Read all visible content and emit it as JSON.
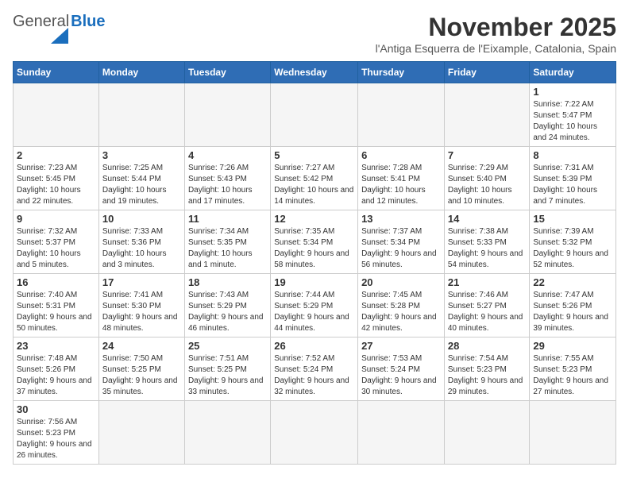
{
  "header": {
    "logo_general": "General",
    "logo_blue": "Blue",
    "month_title": "November 2025",
    "subtitle": "l'Antiga Esquerra de l'Eixample, Catalonia, Spain"
  },
  "days_of_week": [
    "Sunday",
    "Monday",
    "Tuesday",
    "Wednesday",
    "Thursday",
    "Friday",
    "Saturday"
  ],
  "weeks": [
    [
      {
        "day": "",
        "info": ""
      },
      {
        "day": "",
        "info": ""
      },
      {
        "day": "",
        "info": ""
      },
      {
        "day": "",
        "info": ""
      },
      {
        "day": "",
        "info": ""
      },
      {
        "day": "",
        "info": ""
      },
      {
        "day": "1",
        "info": "Sunrise: 7:22 AM\nSunset: 5:47 PM\nDaylight: 10 hours and 24 minutes."
      }
    ],
    [
      {
        "day": "2",
        "info": "Sunrise: 7:23 AM\nSunset: 5:45 PM\nDaylight: 10 hours and 22 minutes."
      },
      {
        "day": "3",
        "info": "Sunrise: 7:25 AM\nSunset: 5:44 PM\nDaylight: 10 hours and 19 minutes."
      },
      {
        "day": "4",
        "info": "Sunrise: 7:26 AM\nSunset: 5:43 PM\nDaylight: 10 hours and 17 minutes."
      },
      {
        "day": "5",
        "info": "Sunrise: 7:27 AM\nSunset: 5:42 PM\nDaylight: 10 hours and 14 minutes."
      },
      {
        "day": "6",
        "info": "Sunrise: 7:28 AM\nSunset: 5:41 PM\nDaylight: 10 hours and 12 minutes."
      },
      {
        "day": "7",
        "info": "Sunrise: 7:29 AM\nSunset: 5:40 PM\nDaylight: 10 hours and 10 minutes."
      },
      {
        "day": "8",
        "info": "Sunrise: 7:31 AM\nSunset: 5:39 PM\nDaylight: 10 hours and 7 minutes."
      }
    ],
    [
      {
        "day": "9",
        "info": "Sunrise: 7:32 AM\nSunset: 5:37 PM\nDaylight: 10 hours and 5 minutes."
      },
      {
        "day": "10",
        "info": "Sunrise: 7:33 AM\nSunset: 5:36 PM\nDaylight: 10 hours and 3 minutes."
      },
      {
        "day": "11",
        "info": "Sunrise: 7:34 AM\nSunset: 5:35 PM\nDaylight: 10 hours and 1 minute."
      },
      {
        "day": "12",
        "info": "Sunrise: 7:35 AM\nSunset: 5:34 PM\nDaylight: 9 hours and 58 minutes."
      },
      {
        "day": "13",
        "info": "Sunrise: 7:37 AM\nSunset: 5:34 PM\nDaylight: 9 hours and 56 minutes."
      },
      {
        "day": "14",
        "info": "Sunrise: 7:38 AM\nSunset: 5:33 PM\nDaylight: 9 hours and 54 minutes."
      },
      {
        "day": "15",
        "info": "Sunrise: 7:39 AM\nSunset: 5:32 PM\nDaylight: 9 hours and 52 minutes."
      }
    ],
    [
      {
        "day": "16",
        "info": "Sunrise: 7:40 AM\nSunset: 5:31 PM\nDaylight: 9 hours and 50 minutes."
      },
      {
        "day": "17",
        "info": "Sunrise: 7:41 AM\nSunset: 5:30 PM\nDaylight: 9 hours and 48 minutes."
      },
      {
        "day": "18",
        "info": "Sunrise: 7:43 AM\nSunset: 5:29 PM\nDaylight: 9 hours and 46 minutes."
      },
      {
        "day": "19",
        "info": "Sunrise: 7:44 AM\nSunset: 5:29 PM\nDaylight: 9 hours and 44 minutes."
      },
      {
        "day": "20",
        "info": "Sunrise: 7:45 AM\nSunset: 5:28 PM\nDaylight: 9 hours and 42 minutes."
      },
      {
        "day": "21",
        "info": "Sunrise: 7:46 AM\nSunset: 5:27 PM\nDaylight: 9 hours and 40 minutes."
      },
      {
        "day": "22",
        "info": "Sunrise: 7:47 AM\nSunset: 5:26 PM\nDaylight: 9 hours and 39 minutes."
      }
    ],
    [
      {
        "day": "23",
        "info": "Sunrise: 7:48 AM\nSunset: 5:26 PM\nDaylight: 9 hours and 37 minutes."
      },
      {
        "day": "24",
        "info": "Sunrise: 7:50 AM\nSunset: 5:25 PM\nDaylight: 9 hours and 35 minutes."
      },
      {
        "day": "25",
        "info": "Sunrise: 7:51 AM\nSunset: 5:25 PM\nDaylight: 9 hours and 33 minutes."
      },
      {
        "day": "26",
        "info": "Sunrise: 7:52 AM\nSunset: 5:24 PM\nDaylight: 9 hours and 32 minutes."
      },
      {
        "day": "27",
        "info": "Sunrise: 7:53 AM\nSunset: 5:24 PM\nDaylight: 9 hours and 30 minutes."
      },
      {
        "day": "28",
        "info": "Sunrise: 7:54 AM\nSunset: 5:23 PM\nDaylight: 9 hours and 29 minutes."
      },
      {
        "day": "29",
        "info": "Sunrise: 7:55 AM\nSunset: 5:23 PM\nDaylight: 9 hours and 27 minutes."
      }
    ],
    [
      {
        "day": "30",
        "info": "Sunrise: 7:56 AM\nSunset: 5:23 PM\nDaylight: 9 hours and 26 minutes."
      },
      {
        "day": "",
        "info": ""
      },
      {
        "day": "",
        "info": ""
      },
      {
        "day": "",
        "info": ""
      },
      {
        "day": "",
        "info": ""
      },
      {
        "day": "",
        "info": ""
      },
      {
        "day": "",
        "info": ""
      }
    ]
  ]
}
